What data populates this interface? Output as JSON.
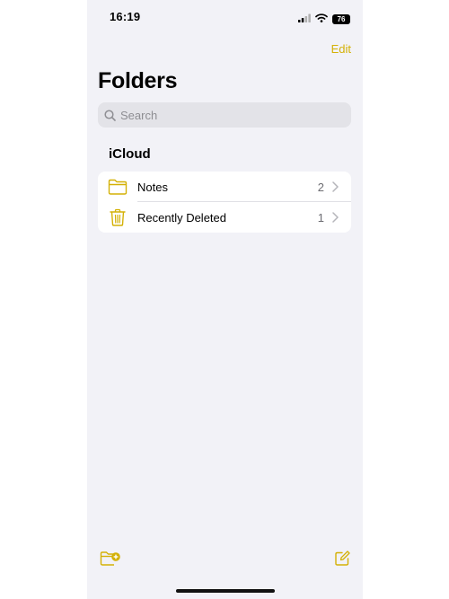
{
  "status_bar": {
    "time": "16:19",
    "battery": "76"
  },
  "header": {
    "edit_label": "Edit",
    "title": "Folders"
  },
  "search": {
    "placeholder": "Search"
  },
  "section": {
    "title": "iCloud"
  },
  "folders": [
    {
      "name": "Notes",
      "count": "2",
      "icon": "folder-icon"
    },
    {
      "name": "Recently Deleted",
      "count": "1",
      "icon": "trash-icon"
    }
  ],
  "toolbar": {
    "left_icon": "new-folder-icon",
    "right_icon": "compose-icon"
  },
  "colors": {
    "accent": "#d4b106",
    "background": "#f2f2f7"
  }
}
